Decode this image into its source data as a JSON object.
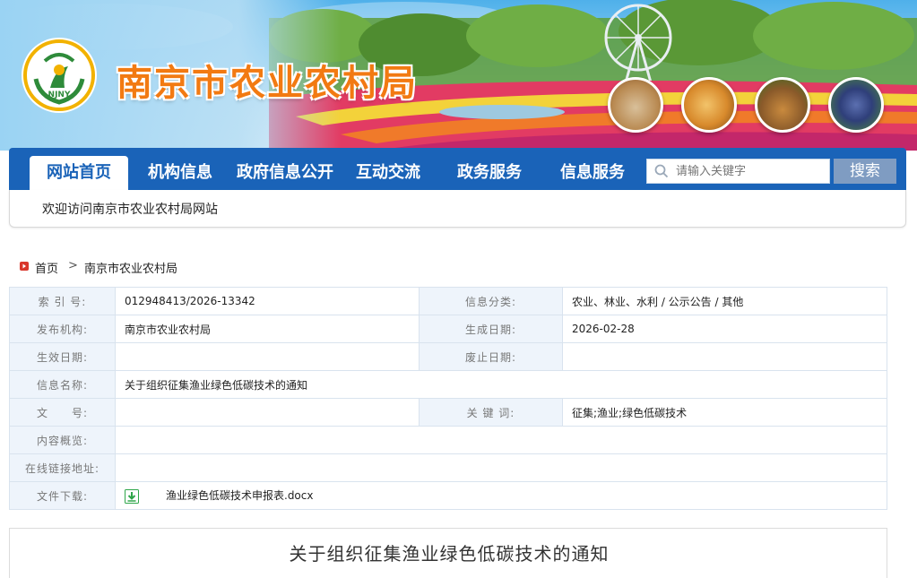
{
  "site": {
    "title": "南京市农业农村局",
    "logo_text": "NJNY"
  },
  "nav": {
    "items": [
      {
        "label": "网站首页",
        "active": true
      },
      {
        "label": "机构信息"
      },
      {
        "label": "政府信息公开"
      },
      {
        "label": "互动交流"
      },
      {
        "label": "政务服务"
      },
      {
        "label": "信息服务"
      }
    ],
    "search_placeholder": "请输入关键字",
    "search_button": "搜索"
  },
  "welcome": "欢迎访问南京市农业农村局网站",
  "breadcrumb": [
    "首页",
    "南京市农业农村局"
  ],
  "info": {
    "index_label": "索 引 号:",
    "index_value": "012948413/2026-13342",
    "category_label": "信息分类:",
    "category_value": "农业、林业、水利 / 公示公告 / 其他",
    "publisher_label": "发布机构:",
    "publisher_value": "南京市农业农村局",
    "created_label": "生成日期:",
    "created_value": "2026-02-28",
    "effective_label": "生效日期:",
    "effective_value": "",
    "abolished_label": "废止日期:",
    "abolished_value": "",
    "name_label": "信息名称:",
    "name_value": "关于组织征集渔业绿色低碳技术的通知",
    "docno_label": "文　　号:",
    "docno_value": "",
    "keywords_label": "关 键 词:",
    "keywords_value": "征集;渔业;绿色低碳技术",
    "summary_label": "内容概览:",
    "summary_value": "",
    "link_label": "在线链接地址:",
    "link_value": "",
    "download_label": "文件下载:",
    "download_file": "渔业绿色低碳技术申报表.docx"
  },
  "article": {
    "title": "关于组织征集渔业绿色低碳技术的通知"
  },
  "colors": {
    "nav_blue": "#1a63b8",
    "title_orange": "#f27a12",
    "label_bg": "#eef4fb"
  }
}
